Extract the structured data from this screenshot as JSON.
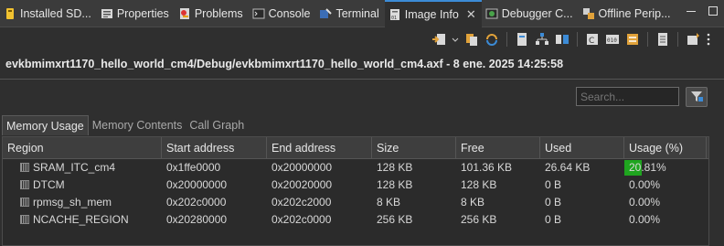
{
  "tabs": [
    {
      "label": "Installed SD...",
      "icon": "installed-sdk-icon",
      "active": false
    },
    {
      "label": "Properties",
      "icon": "properties-icon",
      "active": false
    },
    {
      "label": "Problems",
      "icon": "problems-icon",
      "active": false
    },
    {
      "label": "Console",
      "icon": "console-icon",
      "active": false
    },
    {
      "label": "Terminal",
      "icon": "terminal-icon",
      "active": false
    },
    {
      "label": "Image Info",
      "icon": "image-info-icon",
      "active": true
    },
    {
      "label": "Debugger C...",
      "icon": "debugger-console-icon",
      "active": false
    },
    {
      "label": "Offline Perip...",
      "icon": "offline-peripherals-icon",
      "active": false
    }
  ],
  "file_title": "evkbmimxrt1170_hello_world_cm4/Debug/evkbmimxrt1170_hello_world_cm4.axf - 8 ene. 2025 14:25:58",
  "search": {
    "placeholder": "Search..."
  },
  "subtabs": [
    {
      "label": "Memory Usage",
      "active": true
    },
    {
      "label": "Memory Contents",
      "active": false
    },
    {
      "label": "Call Graph",
      "active": false
    }
  ],
  "table": {
    "headers": [
      "Region",
      "Start address",
      "End address",
      "Size",
      "Free",
      "Used",
      "Usage (%)"
    ],
    "rows": [
      {
        "region": "SRAM_ITC_cm4",
        "start": "0x1ffe0000",
        "end": "0x20000000",
        "size": "128 KB",
        "free": "101.36 KB",
        "used": "26.64 KB",
        "usage": "20.81%",
        "usage_value": 20.81
      },
      {
        "region": "DTCM",
        "start": "0x20000000",
        "end": "0x20020000",
        "size": "128 KB",
        "free": "128 KB",
        "used": "0 B",
        "usage": "0.00%",
        "usage_value": 0
      },
      {
        "region": "rpmsg_sh_mem",
        "start": "0x202c0000",
        "end": "0x202c2000",
        "size": "8 KB",
        "free": "8 KB",
        "used": "0 B",
        "usage": "0.00%",
        "usage_value": 0
      },
      {
        "region": "NCACHE_REGION",
        "start": "0x20280000",
        "end": "0x202c0000",
        "size": "256 KB",
        "free": "256 KB",
        "used": "0 B",
        "usage": "0.00%",
        "usage_value": 0
      }
    ]
  },
  "colors": {
    "accent": "#3c8bd6",
    "usage_bar": "#1fa51f"
  }
}
